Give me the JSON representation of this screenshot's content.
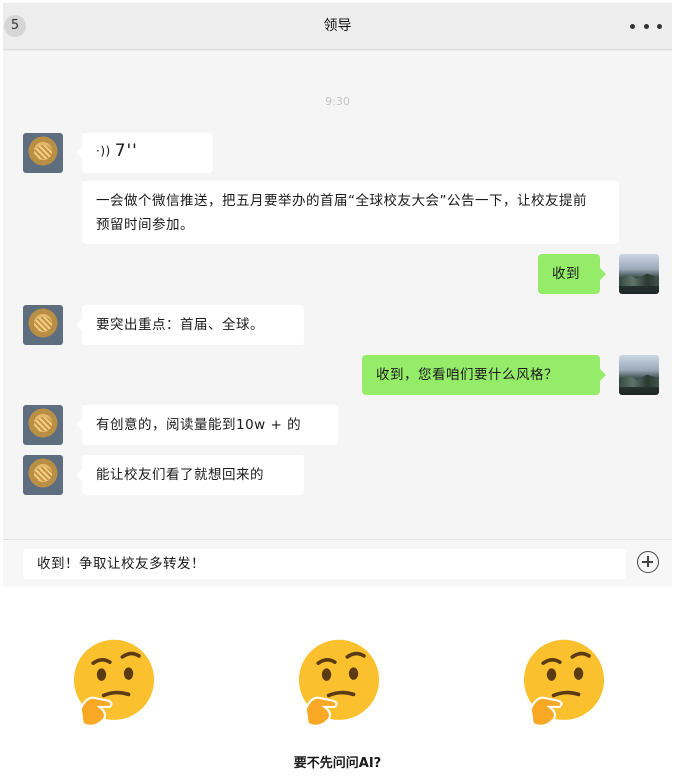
{
  "header": {
    "back_badge": "5",
    "title": "领导",
    "more_icon": "more-horizontal-icon"
  },
  "timestamp": "9:30",
  "messages": [
    {
      "from": "leader",
      "type": "voice",
      "icon": "voice-wave-icon",
      "duration": "7''"
    },
    {
      "from": "leader",
      "type": "text",
      "line1": "一会做个微信推送，把五月要举办的首届“全球校友大会”公告一下，让校友提前",
      "line2": "预留时间参加。"
    },
    {
      "from": "me",
      "type": "text",
      "text": "收到"
    },
    {
      "from": "leader",
      "type": "text",
      "text": "要突出重点：首届、全球。"
    },
    {
      "from": "me",
      "type": "text",
      "text": "收到，您看咱们要什么风格？"
    },
    {
      "from": "leader",
      "type": "text",
      "text": "有创意的，阅读量能到10w + 的"
    },
    {
      "from": "leader",
      "type": "text",
      "text": "能让校友们看了就想回来的"
    }
  ],
  "input": {
    "value": "收到！争取让校友多转发！",
    "plus_icon": "plus-circle-icon"
  },
  "footer": {
    "emoji_icon": "thinking-face-emoji",
    "caption": "要不先问问AI?"
  },
  "colors": {
    "my_bubble": "#95ec69",
    "their_bubble": "#ffffff",
    "chat_background": "#f5f5f5",
    "header_background": "#ededed"
  }
}
